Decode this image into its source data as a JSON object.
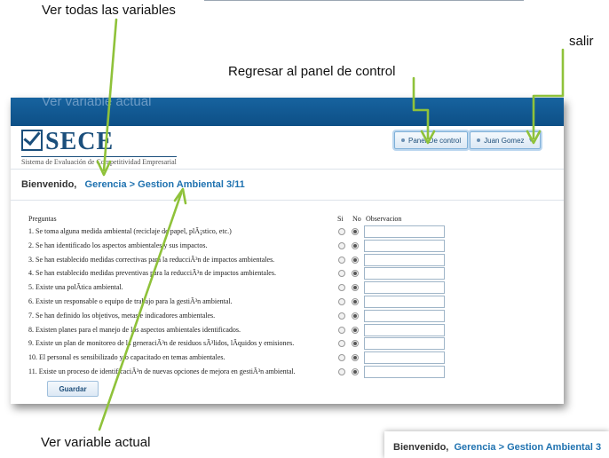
{
  "annotations": {
    "ver_todas": "Ver todas las variables",
    "salir": "salir",
    "regresar": "Regresar al panel de control",
    "ver_actual_bottom": "Ver variable actual",
    "ver_actual_ghost": "Ver variable actual"
  },
  "logo": {
    "name": "SECE",
    "subtitle": "Sistema de Evaluación de Competitividad Empresarial"
  },
  "header_buttons": {
    "panel": "Panel De control",
    "user": "Juan Gomez"
  },
  "breadcrumb": {
    "welcome": "Bienvenido,",
    "level1": "Gerencia",
    "separator": ">",
    "level2": "Gestion Ambiental 3/11"
  },
  "form": {
    "col_preguntas": "Preguntas",
    "col_si": "Si",
    "col_no": "No",
    "col_obs": "Observacion",
    "questions": [
      "1. Se toma alguna medida ambiental (reciclaje de papel, plÃ¡stico, etc.)",
      "2. Se han identificado los aspectos ambientales y sus impactos.",
      "3. Se han establecido medidas correctivas para la reducciÃ³n de impactos ambientales.",
      "4. Se han establecido medidas preventivas para la reducciÃ³n de impactos ambientales.",
      "5. Existe una polÃtica ambiental.",
      "6. Existe un responsable o equipo de trabajo para la gestiÃ³n ambiental.",
      "7. Se han definido los objetivos, metas e indicadores ambientales.",
      "8. Existen planes para el manejo de los aspectos ambientales identificados.",
      "9. Existe un plan de monitoreo de la generaciÃ³n de residuos sÃ³lidos, lÃquidos y emisiones.",
      "10. El personal es sensibilizado y/o capacitado en temas ambientales.",
      "11. Existe un proceso de identificaciÃ³n de nuevas opciones de mejora en gestiÃ³n ambiental."
    ],
    "selected": "No",
    "save_label": "Guardar"
  },
  "snippet": {
    "welcome": "Bienvenido,",
    "level1": "Gerencia",
    "separator": ">",
    "level2": "Gestion Ambiental 3"
  },
  "colors": {
    "topbar": "#0d4f86",
    "link": "#1f72b0",
    "arrow": "#8fc23a"
  }
}
